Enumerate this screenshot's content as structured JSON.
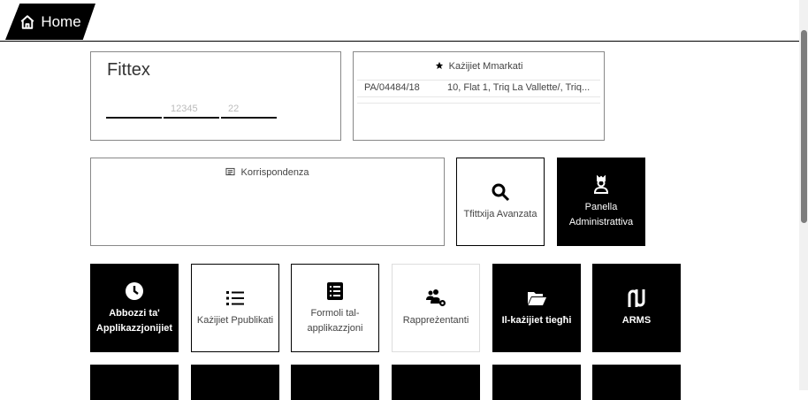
{
  "header": {
    "home_label": "Home",
    "home_icon": "house-icon"
  },
  "search": {
    "title": "Fittex",
    "field1_placeholder": "",
    "field2_placeholder": "12345",
    "field3_placeholder": "22"
  },
  "favorites": {
    "title": "Każijiet Mmarkati",
    "rows": [
      {
        "ref": "PA/04484/18",
        "address": "10, Flat 1, Triq La Vallette/, Triq..."
      }
    ]
  },
  "correspondence": {
    "title": "Korrispondenza"
  },
  "tiles_row1": {
    "advanced_search": "Tfittxija Avanzata",
    "admin_panel": "Panella Administrattiva"
  },
  "tiles_row2": [
    {
      "label": "Abbozzi ta' Applikazzjonijiet",
      "icon": "clock-icon"
    },
    {
      "label": "Każijiet Ppublikati",
      "icon": "list-icon"
    },
    {
      "label": "Formoli tal-applikazzjoni",
      "icon": "form-list-icon"
    },
    {
      "label": "Rappreżentanti",
      "icon": "users-gear-icon"
    },
    {
      "label": "Il-każijiet tiegħi",
      "icon": "folder-open-icon"
    },
    {
      "label": "ARMS",
      "icon": "arms-logo-icon"
    }
  ]
}
